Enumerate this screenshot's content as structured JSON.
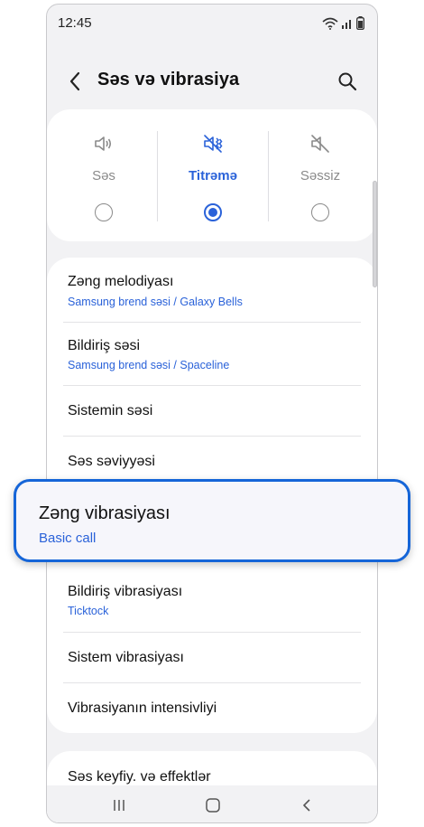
{
  "status_bar": {
    "time": "12:45"
  },
  "header": {
    "title": "Səs və vibrasiya"
  },
  "sound_modes": [
    {
      "label": "Səs",
      "icon": "speaker-icon",
      "selected": false
    },
    {
      "label": "Titrəmə",
      "icon": "vibrate-icon",
      "selected": true
    },
    {
      "label": "Səssiz",
      "icon": "mute-icon",
      "selected": false
    }
  ],
  "settings": {
    "ringtone": {
      "title": "Zəng melodiyası",
      "subtitle": "Samsung brend səsi / Galaxy Bells"
    },
    "notification_sound": {
      "title": "Bildiriş səsi",
      "subtitle": "Samsung brend səsi / Spaceline"
    },
    "system_sound": {
      "title": "Sistemin səsi"
    },
    "volume": {
      "title": "Səs səviyyəsi"
    },
    "call_vibration": {
      "title": "Zəng vibrasiyası",
      "subtitle": "Basic call"
    },
    "notification_vibration": {
      "title": "Bildiriş vibrasiyası",
      "subtitle": "Ticktock"
    },
    "system_vibration": {
      "title": "Sistem vibrasiyası"
    },
    "vibration_intensity": {
      "title": "Vibrasiyanın intensivliyi"
    },
    "sound_quality": {
      "title": "Səs keyfiy. və effektlər"
    }
  },
  "colors": {
    "accent": "#2a62d9",
    "highlight_border": "#1565d8",
    "background": "#f2f2f4"
  }
}
